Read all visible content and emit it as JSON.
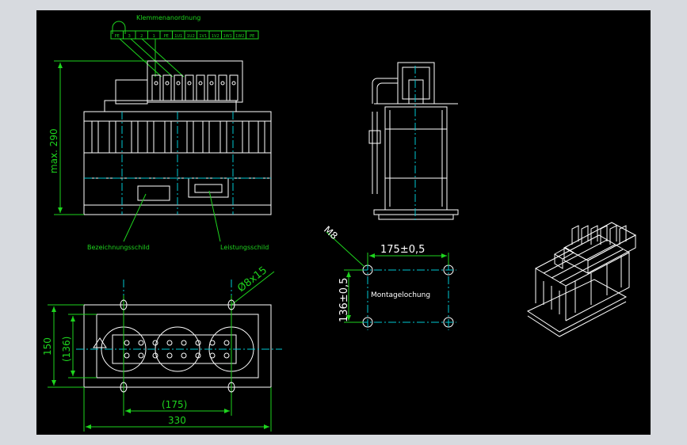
{
  "colors": {
    "background": "#000000",
    "frame": "#d7dadf",
    "geometry": "#ffffff",
    "dimension": "#1ed41e",
    "centerline": "#00c8d2",
    "terminal_strip": "#1ed41e"
  },
  "drawing": {
    "terminal_label": "Klemmenanordnung",
    "terminals": [
      "PE",
      "3",
      "2",
      "1",
      "PE",
      "1U1",
      "1U2",
      "1V1",
      "1V2",
      "1W1",
      "1W2",
      "PE"
    ],
    "dim_height": "max. 290",
    "label_nameplate": "Bezeichnungsschild",
    "label_ratingplate": "Leistungsschild",
    "dim_hole": "Ø8x15",
    "dim_height_150": "150",
    "dim_height_136": "(136)",
    "dim_width_175": "(175)",
    "dim_width_330": "330",
    "dim_mount_width": "175±0,5",
    "dim_mount_height": "136±0,5",
    "dim_mount_hole": "M8",
    "label_mounting": "Montagelochung"
  }
}
